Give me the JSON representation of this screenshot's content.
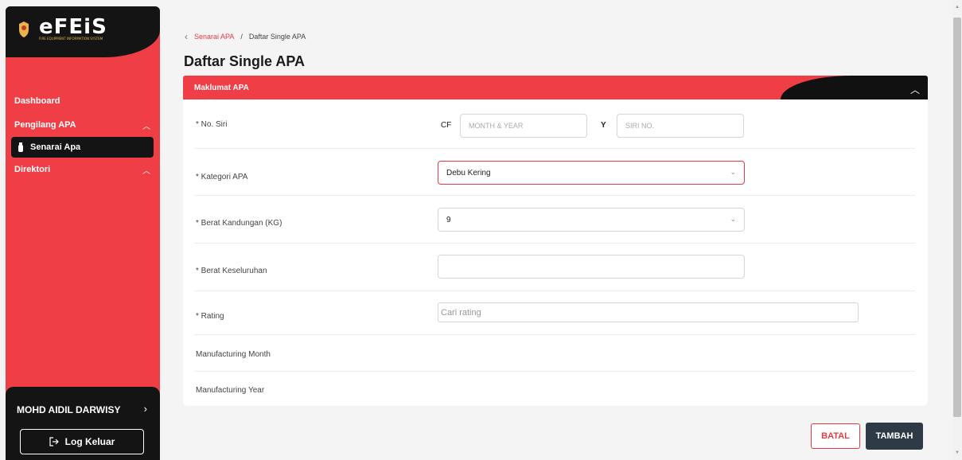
{
  "brand": {
    "logo_text": "eFEiS",
    "logo_sub": "FIRE EQUIPMENT INFORMATION SYSTEM"
  },
  "sidebar": {
    "items": [
      {
        "label": "Dashboard"
      },
      {
        "label": "Pengilang APA",
        "expanded": true
      },
      {
        "label": "Senarai Apa",
        "active": true
      },
      {
        "label": "Direktori",
        "expanded": true
      }
    ],
    "user_name": "MOHD AIDIL DARWISY",
    "logout_label": "Log Keluar"
  },
  "breadcrumb": {
    "parent": "Senarai APA",
    "separator": "/",
    "current": "Daftar Single APA"
  },
  "page_title": "Daftar Single APA",
  "section": {
    "title": "Maklumat APA"
  },
  "form": {
    "no_siri": {
      "label": "* No. Siri",
      "prefix1": "CF",
      "placeholder1": "MONTH & YEAR",
      "prefix2": "Y",
      "placeholder2": "SIRI NO."
    },
    "kategori": {
      "label": "* Kategori APA",
      "value": "Debu Kering"
    },
    "berat_kandungan": {
      "label": "* Berat Kandungan (KG)",
      "value": "9"
    },
    "berat_keseluruhan": {
      "label": "* Berat Keseluruhan",
      "value": ""
    },
    "rating": {
      "label": "* Rating",
      "placeholder": "Cari rating"
    },
    "manufacturing_month": {
      "label": "Manufacturing Month"
    },
    "manufacturing_year": {
      "label": "Manufacturing Year"
    }
  },
  "actions": {
    "cancel_label": "BATAL",
    "submit_label": "TAMBAH"
  },
  "colors": {
    "accent": "#f03e46",
    "dark": "#141414",
    "button_dark": "#2e3a45"
  }
}
